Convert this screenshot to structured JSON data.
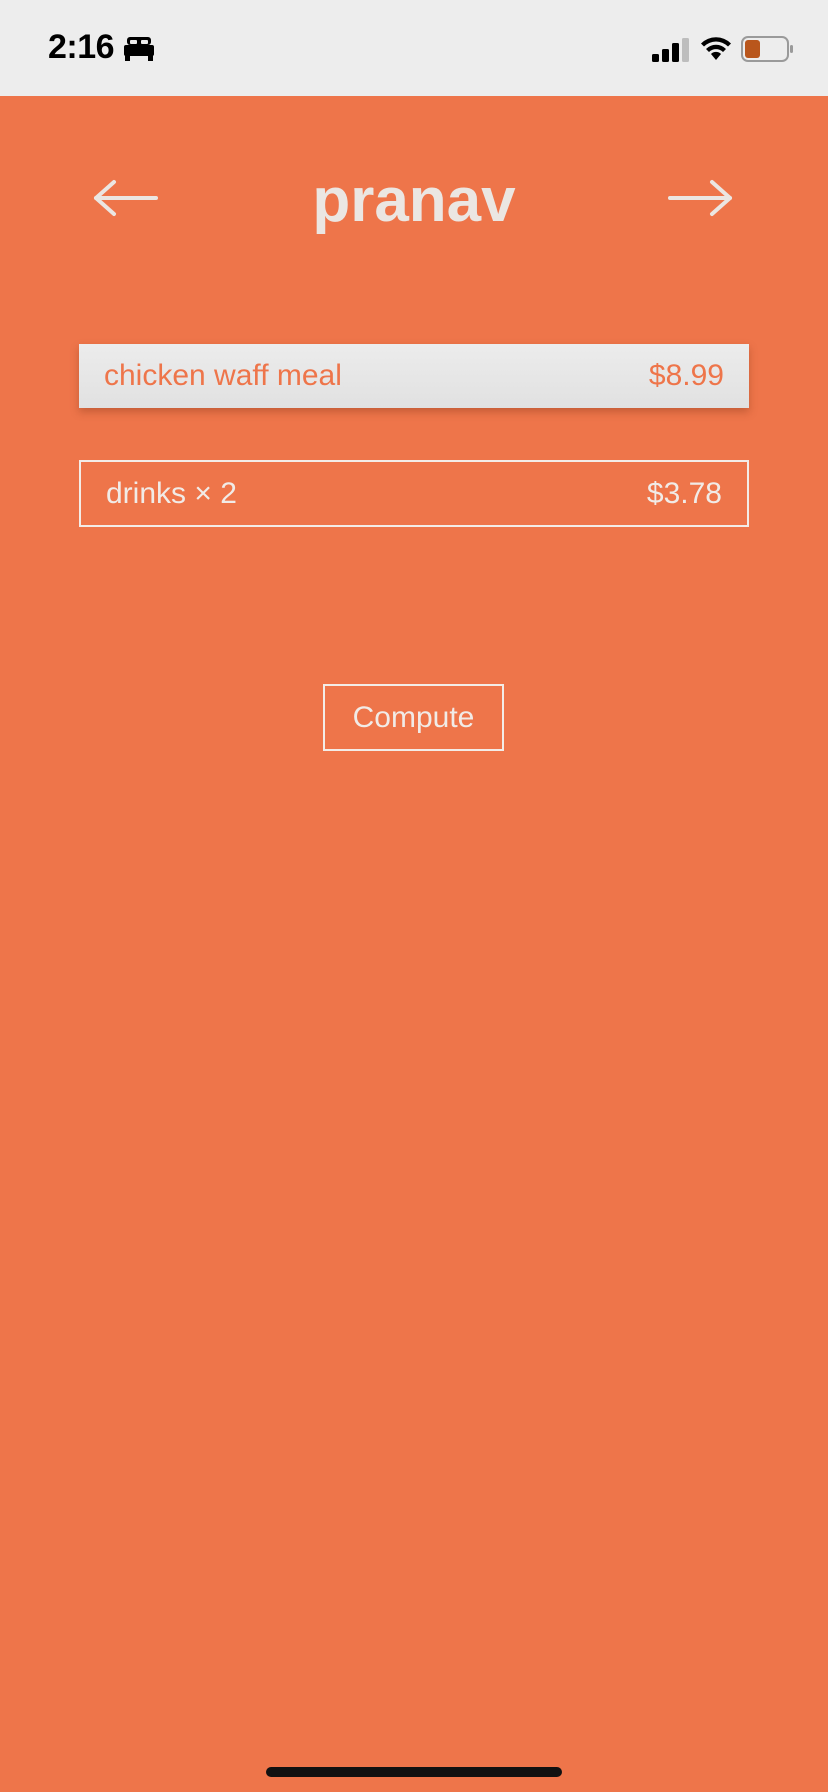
{
  "status_bar": {
    "time": "2:16",
    "bed_icon": "bed-icon",
    "signal_icon": "cellular-signal-icon",
    "wifi_icon": "wifi-icon",
    "battery_icon": "battery-icon",
    "battery_color": "#b9561c"
  },
  "header": {
    "title": "pranav",
    "back_icon": "left-arrow-icon",
    "forward_icon": "right-arrow-icon"
  },
  "items": [
    {
      "name": "chicken waff meal",
      "price": "$8.99",
      "selected": true
    },
    {
      "name": "drinks × 2",
      "price": "$3.78",
      "selected": false
    }
  ],
  "actions": {
    "compute_label": "Compute"
  },
  "colors": {
    "accent": "#ee754a",
    "status_bar_bg": "#ededed",
    "text_light": "#ebe6e2",
    "selected_bg": "#e6e6e6"
  }
}
